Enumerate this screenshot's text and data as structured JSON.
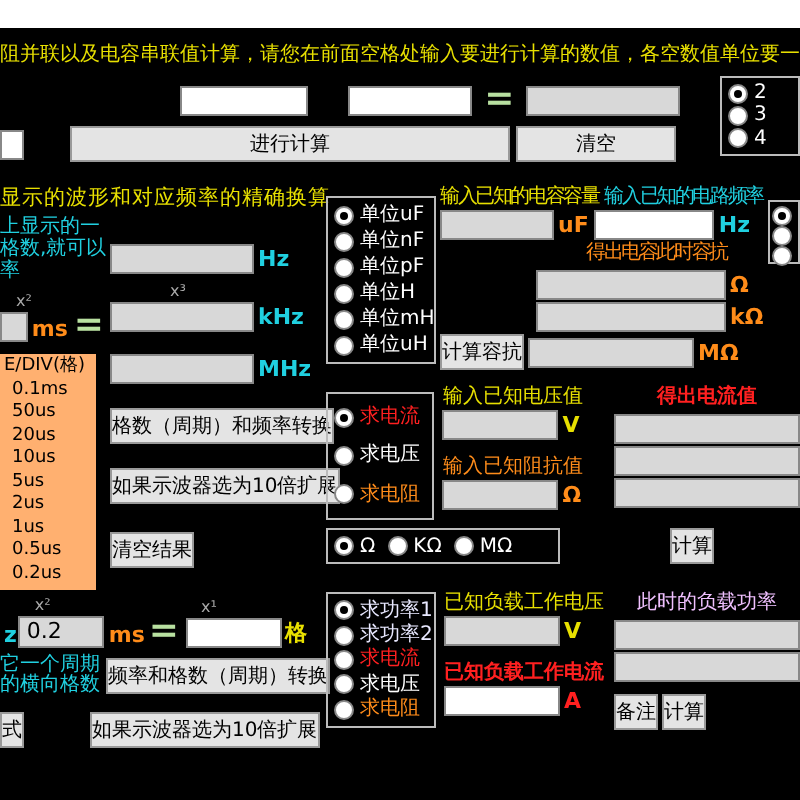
{
  "heading": "阻并联以及电容串联值计算，请您在前面空格处输入要进行计算的数值，各空数值单位要一",
  "equals_sign": "=",
  "calc_button": "进行计算",
  "clear_button": "清空",
  "count_options": [
    {
      "label": "2",
      "selected": true
    },
    {
      "label": "3",
      "selected": false
    },
    {
      "label": "4",
      "selected": false
    }
  ],
  "wave": {
    "title": "显示的波形和对应频率的精确换算",
    "note": [
      "上显示的一",
      "格数,就可以",
      "率"
    ],
    "period_exponent": "x²",
    "period_unit": "ms",
    "equals_sign": "=",
    "freq_exponent": "x³",
    "freq_units": [
      "Hz",
      "kHz",
      "MHz"
    ],
    "timebase_header": "E/DIV(格)",
    "timebase": [
      "0.1ms",
      "50us",
      "20us",
      "10us",
      "5us",
      "2us",
      "1us",
      "0.5us",
      "0.2us"
    ],
    "buttons": [
      "格数（周期）和频率转换",
      "如果示波器选为10倍扩展",
      "清空结果"
    ]
  },
  "reverse": {
    "edge_label": "z",
    "value_exponent": "x²",
    "value": "0.2",
    "unit": "ms",
    "equals_sign": "=",
    "result_exponent": "x¹",
    "result_unit": "格",
    "note": [
      "它一个周期",
      "的横向格数"
    ],
    "side_button": "式",
    "buttons": [
      "频率和格数（周期）转换",
      "如果示波器选为10倍扩展"
    ]
  },
  "unit_options": [
    {
      "label": "单位uF",
      "selected": true
    },
    {
      "label": "单位nF",
      "selected": false
    },
    {
      "label": "单位pF",
      "selected": false
    },
    {
      "label": "单位H",
      "selected": false
    },
    {
      "label": "单位mH",
      "selected": false
    },
    {
      "label": "单位uH",
      "selected": false
    }
  ],
  "mode_options": [
    {
      "label": "求电流",
      "selected": true,
      "color": "#ff2020"
    },
    {
      "label": "求电压",
      "selected": false,
      "color": "#ffffff"
    },
    {
      "label": "求电阻",
      "selected": false,
      "color": "#ff8c1a"
    }
  ],
  "ohm_units": [
    {
      "label": "Ω",
      "selected": true
    },
    {
      "label": "KΩ",
      "selected": false
    },
    {
      "label": "MΩ",
      "selected": false
    }
  ],
  "power_modes": [
    {
      "label": "求功率1",
      "selected": true,
      "color": "#e8e8ff"
    },
    {
      "label": "求功率2",
      "selected": false,
      "color": "#e8e8ff"
    },
    {
      "label": "求电流",
      "selected": false,
      "color": "#ff2020"
    },
    {
      "label": "求电压",
      "selected": false,
      "color": "#ffffff"
    },
    {
      "label": "求电阻",
      "selected": false,
      "color": "#ff8c1a"
    }
  ],
  "capacitive": {
    "capacity_label": "输入已知的电容容量",
    "capacity_unit": "uF",
    "freq_label": "输入已知的电路频率",
    "freq_unit": "Hz",
    "result_label": "得出电容此时容抗",
    "button": "计算容抗",
    "result_units": [
      "Ω",
      "kΩ",
      "MΩ"
    ]
  },
  "edge_options": [
    {
      "selected": true
    },
    {
      "selected": false
    },
    {
      "selected": false
    }
  ],
  "ohm_law": {
    "voltage_label": "输入已知电压值",
    "voltage_unit": "V",
    "impedance_label": "输入已知阻抗值",
    "impedance_unit": "Ω",
    "result_label": "得出电流值",
    "button": "计算"
  },
  "power": {
    "voltage_label": "已知负载工作电压",
    "voltage_unit": "V",
    "current_label": "已知负载工作电流",
    "current_unit": "A",
    "result_label": "此时的负载功率",
    "note_button": "备注",
    "button": "计算"
  }
}
